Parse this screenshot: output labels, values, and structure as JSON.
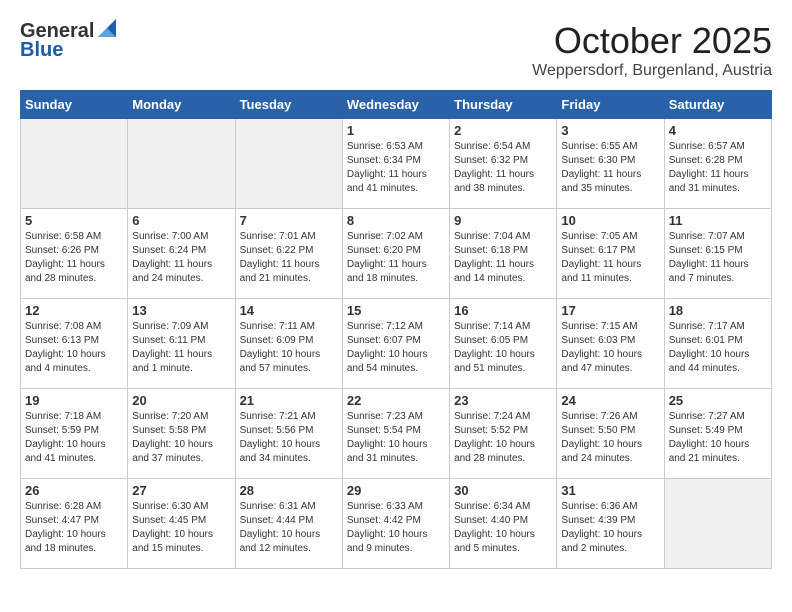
{
  "logo": {
    "general": "General",
    "blue": "Blue"
  },
  "header": {
    "month": "October 2025",
    "location": "Weppersdorf, Burgenland, Austria"
  },
  "weekdays": [
    "Sunday",
    "Monday",
    "Tuesday",
    "Wednesday",
    "Thursday",
    "Friday",
    "Saturday"
  ],
  "weeks": [
    [
      {
        "day": "",
        "empty": true
      },
      {
        "day": "",
        "empty": true
      },
      {
        "day": "",
        "empty": true
      },
      {
        "day": "1",
        "sunrise": "6:53 AM",
        "sunset": "6:34 PM",
        "daylight": "11 hours and 41 minutes."
      },
      {
        "day": "2",
        "sunrise": "6:54 AM",
        "sunset": "6:32 PM",
        "daylight": "11 hours and 38 minutes."
      },
      {
        "day": "3",
        "sunrise": "6:55 AM",
        "sunset": "6:30 PM",
        "daylight": "11 hours and 35 minutes."
      },
      {
        "day": "4",
        "sunrise": "6:57 AM",
        "sunset": "6:28 PM",
        "daylight": "11 hours and 31 minutes."
      }
    ],
    [
      {
        "day": "5",
        "sunrise": "6:58 AM",
        "sunset": "6:26 PM",
        "daylight": "11 hours and 28 minutes."
      },
      {
        "day": "6",
        "sunrise": "7:00 AM",
        "sunset": "6:24 PM",
        "daylight": "11 hours and 24 minutes."
      },
      {
        "day": "7",
        "sunrise": "7:01 AM",
        "sunset": "6:22 PM",
        "daylight": "11 hours and 21 minutes."
      },
      {
        "day": "8",
        "sunrise": "7:02 AM",
        "sunset": "6:20 PM",
        "daylight": "11 hours and 18 minutes."
      },
      {
        "day": "9",
        "sunrise": "7:04 AM",
        "sunset": "6:18 PM",
        "daylight": "11 hours and 14 minutes."
      },
      {
        "day": "10",
        "sunrise": "7:05 AM",
        "sunset": "6:17 PM",
        "daylight": "11 hours and 11 minutes."
      },
      {
        "day": "11",
        "sunrise": "7:07 AM",
        "sunset": "6:15 PM",
        "daylight": "11 hours and 7 minutes."
      }
    ],
    [
      {
        "day": "12",
        "sunrise": "7:08 AM",
        "sunset": "6:13 PM",
        "daylight": "10 hours and 4 minutes."
      },
      {
        "day": "13",
        "sunrise": "7:09 AM",
        "sunset": "6:11 PM",
        "daylight": "11 hours and 1 minute."
      },
      {
        "day": "14",
        "sunrise": "7:11 AM",
        "sunset": "6:09 PM",
        "daylight": "10 hours and 57 minutes."
      },
      {
        "day": "15",
        "sunrise": "7:12 AM",
        "sunset": "6:07 PM",
        "daylight": "10 hours and 54 minutes."
      },
      {
        "day": "16",
        "sunrise": "7:14 AM",
        "sunset": "6:05 PM",
        "daylight": "10 hours and 51 minutes."
      },
      {
        "day": "17",
        "sunrise": "7:15 AM",
        "sunset": "6:03 PM",
        "daylight": "10 hours and 47 minutes."
      },
      {
        "day": "18",
        "sunrise": "7:17 AM",
        "sunset": "6:01 PM",
        "daylight": "10 hours and 44 minutes."
      }
    ],
    [
      {
        "day": "19",
        "sunrise": "7:18 AM",
        "sunset": "5:59 PM",
        "daylight": "10 hours and 41 minutes."
      },
      {
        "day": "20",
        "sunrise": "7:20 AM",
        "sunset": "5:58 PM",
        "daylight": "10 hours and 37 minutes."
      },
      {
        "day": "21",
        "sunrise": "7:21 AM",
        "sunset": "5:56 PM",
        "daylight": "10 hours and 34 minutes."
      },
      {
        "day": "22",
        "sunrise": "7:23 AM",
        "sunset": "5:54 PM",
        "daylight": "10 hours and 31 minutes."
      },
      {
        "day": "23",
        "sunrise": "7:24 AM",
        "sunset": "5:52 PM",
        "daylight": "10 hours and 28 minutes."
      },
      {
        "day": "24",
        "sunrise": "7:26 AM",
        "sunset": "5:50 PM",
        "daylight": "10 hours and 24 minutes."
      },
      {
        "day": "25",
        "sunrise": "7:27 AM",
        "sunset": "5:49 PM",
        "daylight": "10 hours and 21 minutes."
      }
    ],
    [
      {
        "day": "26",
        "sunrise": "6:28 AM",
        "sunset": "4:47 PM",
        "daylight": "10 hours and 18 minutes."
      },
      {
        "day": "27",
        "sunrise": "6:30 AM",
        "sunset": "4:45 PM",
        "daylight": "10 hours and 15 minutes."
      },
      {
        "day": "28",
        "sunrise": "6:31 AM",
        "sunset": "4:44 PM",
        "daylight": "10 hours and 12 minutes."
      },
      {
        "day": "29",
        "sunrise": "6:33 AM",
        "sunset": "4:42 PM",
        "daylight": "10 hours and 9 minutes."
      },
      {
        "day": "30",
        "sunrise": "6:34 AM",
        "sunset": "4:40 PM",
        "daylight": "10 hours and 5 minutes."
      },
      {
        "day": "31",
        "sunrise": "6:36 AM",
        "sunset": "4:39 PM",
        "daylight": "10 hours and 2 minutes."
      },
      {
        "day": "",
        "empty": true
      }
    ]
  ]
}
